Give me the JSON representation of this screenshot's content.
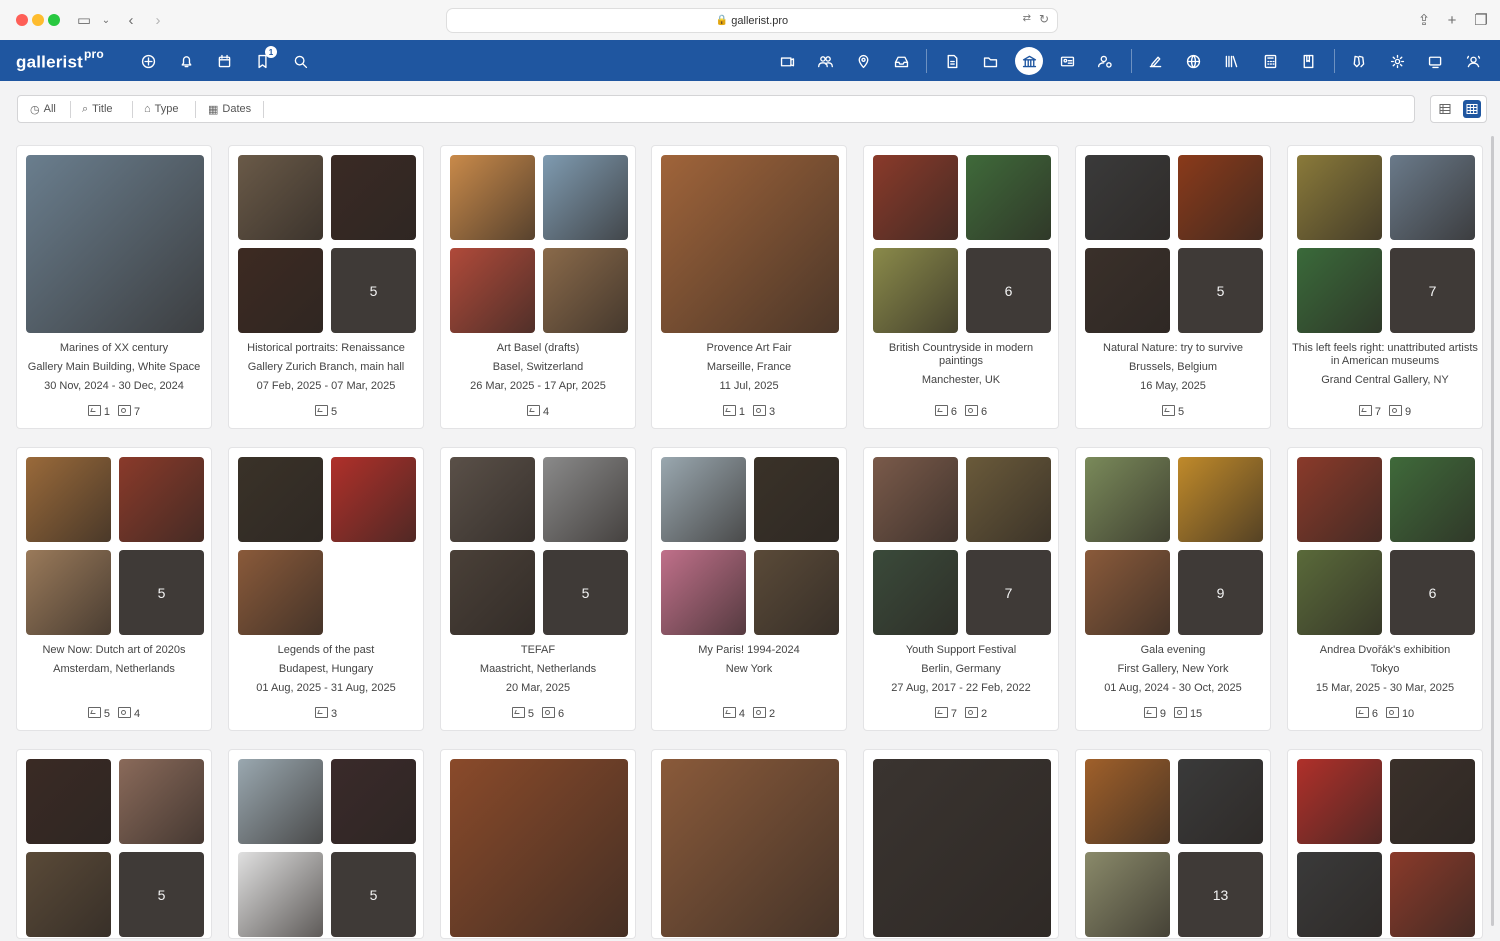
{
  "browser": {
    "url": "gallerist.pro"
  },
  "app": {
    "logo": "gallerist",
    "logo_sup": "pro",
    "notification_count": "1"
  },
  "filters": [
    {
      "label": "All",
      "icon": "clock-icon"
    },
    {
      "label": "Title",
      "icon": "search-icon"
    },
    {
      "label": "Type",
      "icon": "bank-icon"
    },
    {
      "label": "Dates",
      "icon": "calendar-icon"
    }
  ],
  "colors": {
    "brand": "#1f56a0"
  },
  "cards": [
    {
      "layout": "single",
      "colors": [
        "#6a7e8e"
      ],
      "title": "Marines of XX century",
      "sub": "Gallery Main Building, White Space",
      "date": "30 Nov, 2024 - 30 Dec, 2024",
      "c1": "1",
      "c2": "7"
    },
    {
      "layout": "quad",
      "colors": [
        "#6a5a48",
        "#3a2a24",
        "#3d2a22"
      ],
      "more": "5",
      "title": "Historical portraits: Renaissance",
      "sub": "Gallery Zurich Branch, main hall",
      "date": "07 Feb, 2025 - 07 Mar, 2025",
      "c1": "5",
      "c2": ""
    },
    {
      "layout": "quad",
      "colors": [
        "#c98a4a",
        "#7f9bb1",
        "#b04a3a",
        "#8a6a4a"
      ],
      "title": "Art Basel (drafts)",
      "sub": "Basel, Switzerland",
      "date": "26 Mar, 2025 - 17 Apr, 2025",
      "c1": "4",
      "c2": ""
    },
    {
      "layout": "single",
      "colors": [
        "#a0643a"
      ],
      "title": "Provence Art Fair",
      "sub": "Marseille, France",
      "date": "11 Jul, 2025",
      "c1": "1",
      "c2": "3"
    },
    {
      "layout": "quad",
      "colors": [
        "#8a3a2a",
        "#3f6a3a",
        "#8a8a4a"
      ],
      "more": "6",
      "title": "British Countryside in modern paintings",
      "sub": "Manchester, UK",
      "date": "",
      "c1": "6",
      "c2": "6"
    },
    {
      "layout": "quad",
      "colors": [
        "#3a3a3a",
        "#8a3a1a",
        "#3a302a"
      ],
      "more": "5",
      "title": "Natural Nature: try to survive",
      "sub": "Brussels, Belgium",
      "date": "16 May, 2025",
      "c1": "5",
      "c2": ""
    },
    {
      "layout": "quad",
      "colors": [
        "#8a7a3a",
        "#6a7a8a",
        "#3a6a3a"
      ],
      "more": "7",
      "title": "This left feels right: unattributed artists in American museums",
      "sub": "Grand Central Gallery, NY",
      "date": "",
      "c1": "7",
      "c2": "9"
    },
    {
      "layout": "quad",
      "colors": [
        "#9a6a3a",
        "#8a3a2a",
        "#9a7a5a"
      ],
      "more": "5",
      "title": "New Now: Dutch art of 2020s",
      "sub": "Amsterdam, Netherlands",
      "date": "",
      "c1": "5",
      "c2": "4"
    },
    {
      "layout": "three",
      "colors": [
        "#3a3228",
        "#b0302a",
        "#8a5a3a"
      ],
      "title": "Legends of the past",
      "sub": "Budapest, Hungary",
      "date": "01 Aug, 2025 - 31 Aug, 2025",
      "c1": "3",
      "c2": ""
    },
    {
      "layout": "quad",
      "colors": [
        "#5a5048",
        "#8a8a8a",
        "#4a4038"
      ],
      "more": "5",
      "title": "TEFAF",
      "sub": "Maastricht, Netherlands",
      "date": "20 Mar, 2025",
      "c1": "5",
      "c2": "6"
    },
    {
      "layout": "quad",
      "colors": [
        "#9aa8b0",
        "#3a3228",
        "#c0708a",
        "#5a4a38"
      ],
      "title": "My Paris! 1994-2024",
      "sub": "New York",
      "date": "",
      "c1": "4",
      "c2": "2"
    },
    {
      "layout": "quad",
      "colors": [
        "#7a5a4a",
        "#6a5a3a",
        "#3a4a3a"
      ],
      "more": "7",
      "title": "Youth Support Festival",
      "sub": "Berlin, Germany",
      "date": "27 Aug, 2017 - 22 Feb, 2022",
      "c1": "7",
      "c2": "2"
    },
    {
      "layout": "quad",
      "colors": [
        "#7a8a5a",
        "#c08a2a",
        "#8a5a3a"
      ],
      "more": "9",
      "title": "Gala evening",
      "sub": "First Gallery, New York",
      "date": "01 Aug, 2024 - 30 Oct, 2025",
      "c1": "9",
      "c2": "15"
    },
    {
      "layout": "quad",
      "colors": [
        "#8a3a2a",
        "#3f6a3a",
        "#5a6a3a"
      ],
      "more": "6",
      "title": "Andrea Dvořák's exhibition",
      "sub": "Tokyo",
      "date": "15 Mar, 2025 - 30 Mar, 2025",
      "c1": "6",
      "c2": "10"
    },
    {
      "layout": "quad",
      "colors": [
        "#3a2a24",
        "#8a6a5a",
        "#5a4a38"
      ],
      "more": "5"
    },
    {
      "layout": "quad",
      "colors": [
        "#9aa8b0",
        "#3a2a2a",
        "#e0e0e0"
      ],
      "more": "5"
    },
    {
      "layout": "single",
      "colors": [
        "#8a4a2a"
      ]
    },
    {
      "layout": "single",
      "colors": [
        "#8a5a3a"
      ]
    },
    {
      "layout": "single",
      "colors": [
        "#3a3430"
      ]
    },
    {
      "layout": "quad",
      "colors": [
        "#a0602a",
        "#3a3a3a",
        "#8a8a6a"
      ],
      "more": "13"
    },
    {
      "layout": "quad",
      "colors": [
        "#b0302a",
        "#3a302a",
        "#3a3a3a",
        "#8a3a2a"
      ]
    }
  ]
}
